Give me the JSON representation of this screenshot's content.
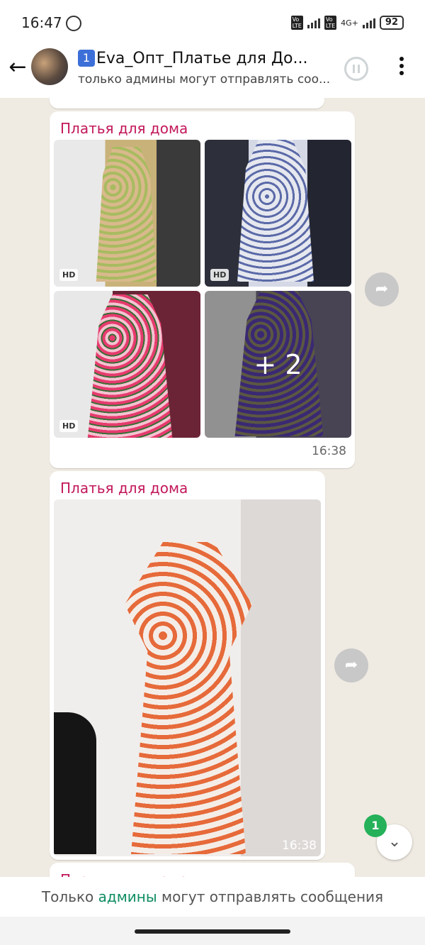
{
  "status_bar": {
    "time": "16:47",
    "network": "4G+",
    "battery": "92"
  },
  "header": {
    "back_icon": "arrow-left-icon",
    "chat_number": "1",
    "chat_title": "Eva_Опт_Платье для До...",
    "subtitle": "только админы могут отправлять соо..."
  },
  "messages": [
    {
      "sender": "Платья для дома",
      "album_more": "+ 2",
      "hd_label": "HD",
      "time": "16:38"
    },
    {
      "sender": "Платья для дома",
      "time": "16:38"
    },
    {
      "sender": "Платья для дома"
    }
  ],
  "footer": {
    "prefix": "Только ",
    "admins": "админы",
    "suffix": " могут отправлять сообщения"
  },
  "unread_count": "1",
  "colors": {
    "sender": "#c2185b",
    "accent_green": "#25b05a",
    "admins_link": "#0f8d61"
  }
}
